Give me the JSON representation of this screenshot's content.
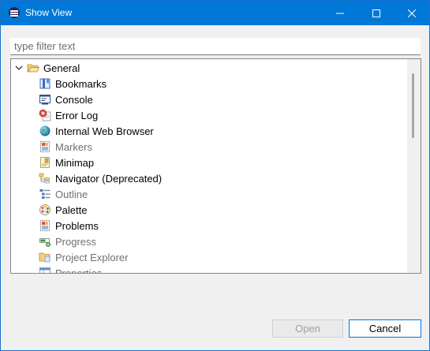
{
  "window": {
    "title": "Show View"
  },
  "filter": {
    "placeholder": "type filter text",
    "value": ""
  },
  "tree": {
    "root": {
      "label": "General",
      "expanded": true,
      "icon": "folder-open-icon"
    },
    "items": [
      {
        "label": "Bookmarks",
        "icon": "bookmarks-icon",
        "enabled": true
      },
      {
        "label": "Console",
        "icon": "console-icon",
        "enabled": true
      },
      {
        "label": "Error Log",
        "icon": "error-log-icon",
        "enabled": true
      },
      {
        "label": "Internal Web Browser",
        "icon": "globe-icon",
        "enabled": true
      },
      {
        "label": "Markers",
        "icon": "markers-icon",
        "enabled": false
      },
      {
        "label": "Minimap",
        "icon": "minimap-icon",
        "enabled": true
      },
      {
        "label": "Navigator (Deprecated)",
        "icon": "navigator-icon",
        "enabled": true
      },
      {
        "label": "Outline",
        "icon": "outline-icon",
        "enabled": false
      },
      {
        "label": "Palette",
        "icon": "palette-icon",
        "enabled": true
      },
      {
        "label": "Problems",
        "icon": "problems-icon",
        "enabled": true
      },
      {
        "label": "Progress",
        "icon": "progress-icon",
        "enabled": false
      },
      {
        "label": "Project Explorer",
        "icon": "project-explorer-icon",
        "enabled": false
      },
      {
        "label": "Properties",
        "icon": "properties-icon",
        "enabled": false
      }
    ]
  },
  "buttons": {
    "open": "Open",
    "cancel": "Cancel",
    "open_enabled": false
  },
  "colors": {
    "titlebar": "#0078d7",
    "accent": "#0078d7",
    "disabled_text": "#707070"
  }
}
